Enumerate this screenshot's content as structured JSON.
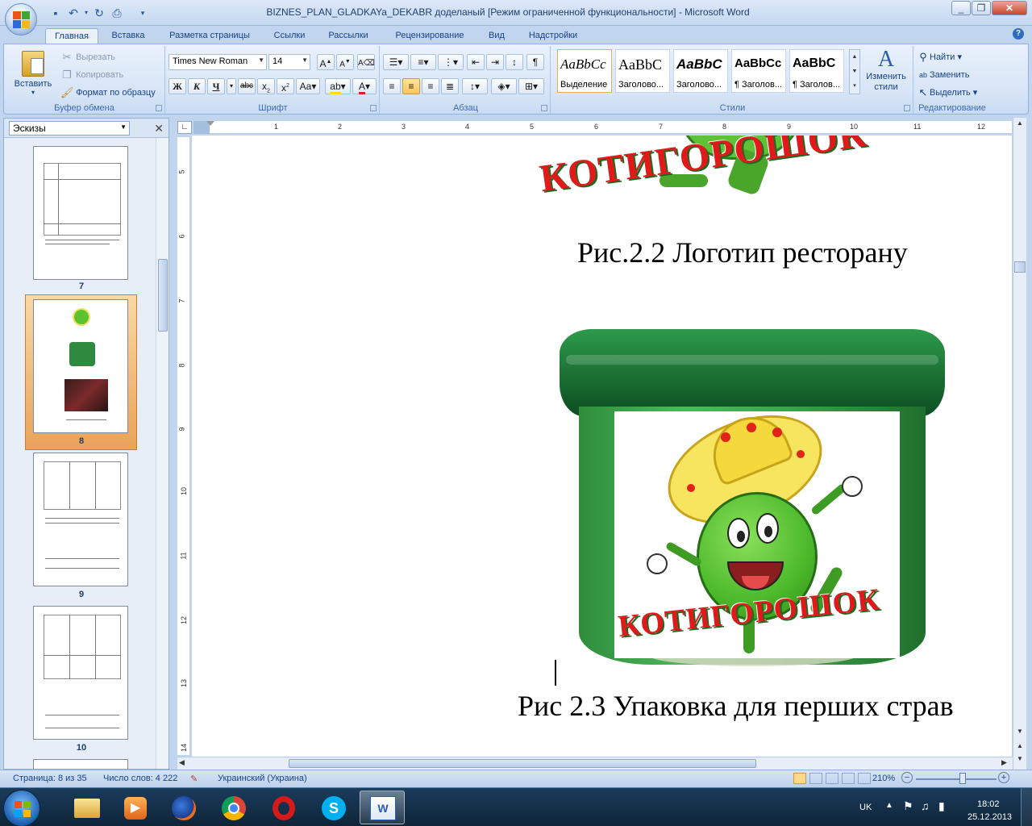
{
  "window": {
    "title": "BIZNES_PLAN_GLADKAYa_DEKABR доделаный [Режим ограниченной функциональности] - Microsoft Word"
  },
  "ribbon_tabs": [
    "Главная",
    "Вставка",
    "Разметка страницы",
    "Ссылки",
    "Рассылки",
    "Рецензирование",
    "Вид",
    "Надстройки"
  ],
  "clipboard": {
    "paste": "Вставить",
    "cut": "Вырезать",
    "copy": "Копировать",
    "format_painter": "Формат по образцу",
    "label": "Буфер обмена"
  },
  "font": {
    "name": "Times New Roman",
    "size": "14",
    "label": "Шрифт"
  },
  "paragraph": {
    "label": "Абзац"
  },
  "styles": {
    "items": [
      {
        "sample": "AaBbCc",
        "name": "Выделение"
      },
      {
        "sample": "AaBbC",
        "name": "Заголово..."
      },
      {
        "sample": "AaBbC",
        "name": "Заголово..."
      },
      {
        "sample": "AaBbCc",
        "name": "¶ Заголов..."
      },
      {
        "sample": "AaBbC",
        "name": "¶ Заголов..."
      }
    ],
    "change": "Изменить стили",
    "label": "Стили"
  },
  "editing": {
    "find": "Найти",
    "replace": "Заменить",
    "select": "Выделить",
    "label": "Редактирование"
  },
  "thumbnails": {
    "view": "Эскизы",
    "pages": [
      "7",
      "8",
      "9",
      "10"
    ]
  },
  "ruler": {
    "numbers": [
      "1",
      "2",
      "3",
      "4",
      "5",
      "6",
      "7",
      "8",
      "9",
      "10",
      "11",
      "12"
    ],
    "vnumbers": [
      "5",
      "6",
      "7",
      "8",
      "9",
      "10",
      "11",
      "12",
      "13",
      "14"
    ]
  },
  "document": {
    "logo_text": "КОТИГОРОШОК",
    "caption1": "Рис.2.2 Логотип ресторану",
    "caption2": "Рис 2.3 Упаковка для перших страв"
  },
  "status": {
    "page": "Страница: 8 из 35",
    "words": "Число слов: 4 222",
    "language": "Украинский (Украина)",
    "zoom": "210%"
  },
  "tray": {
    "lang": "UK",
    "time": "18:02",
    "date": "25.12.2013"
  }
}
